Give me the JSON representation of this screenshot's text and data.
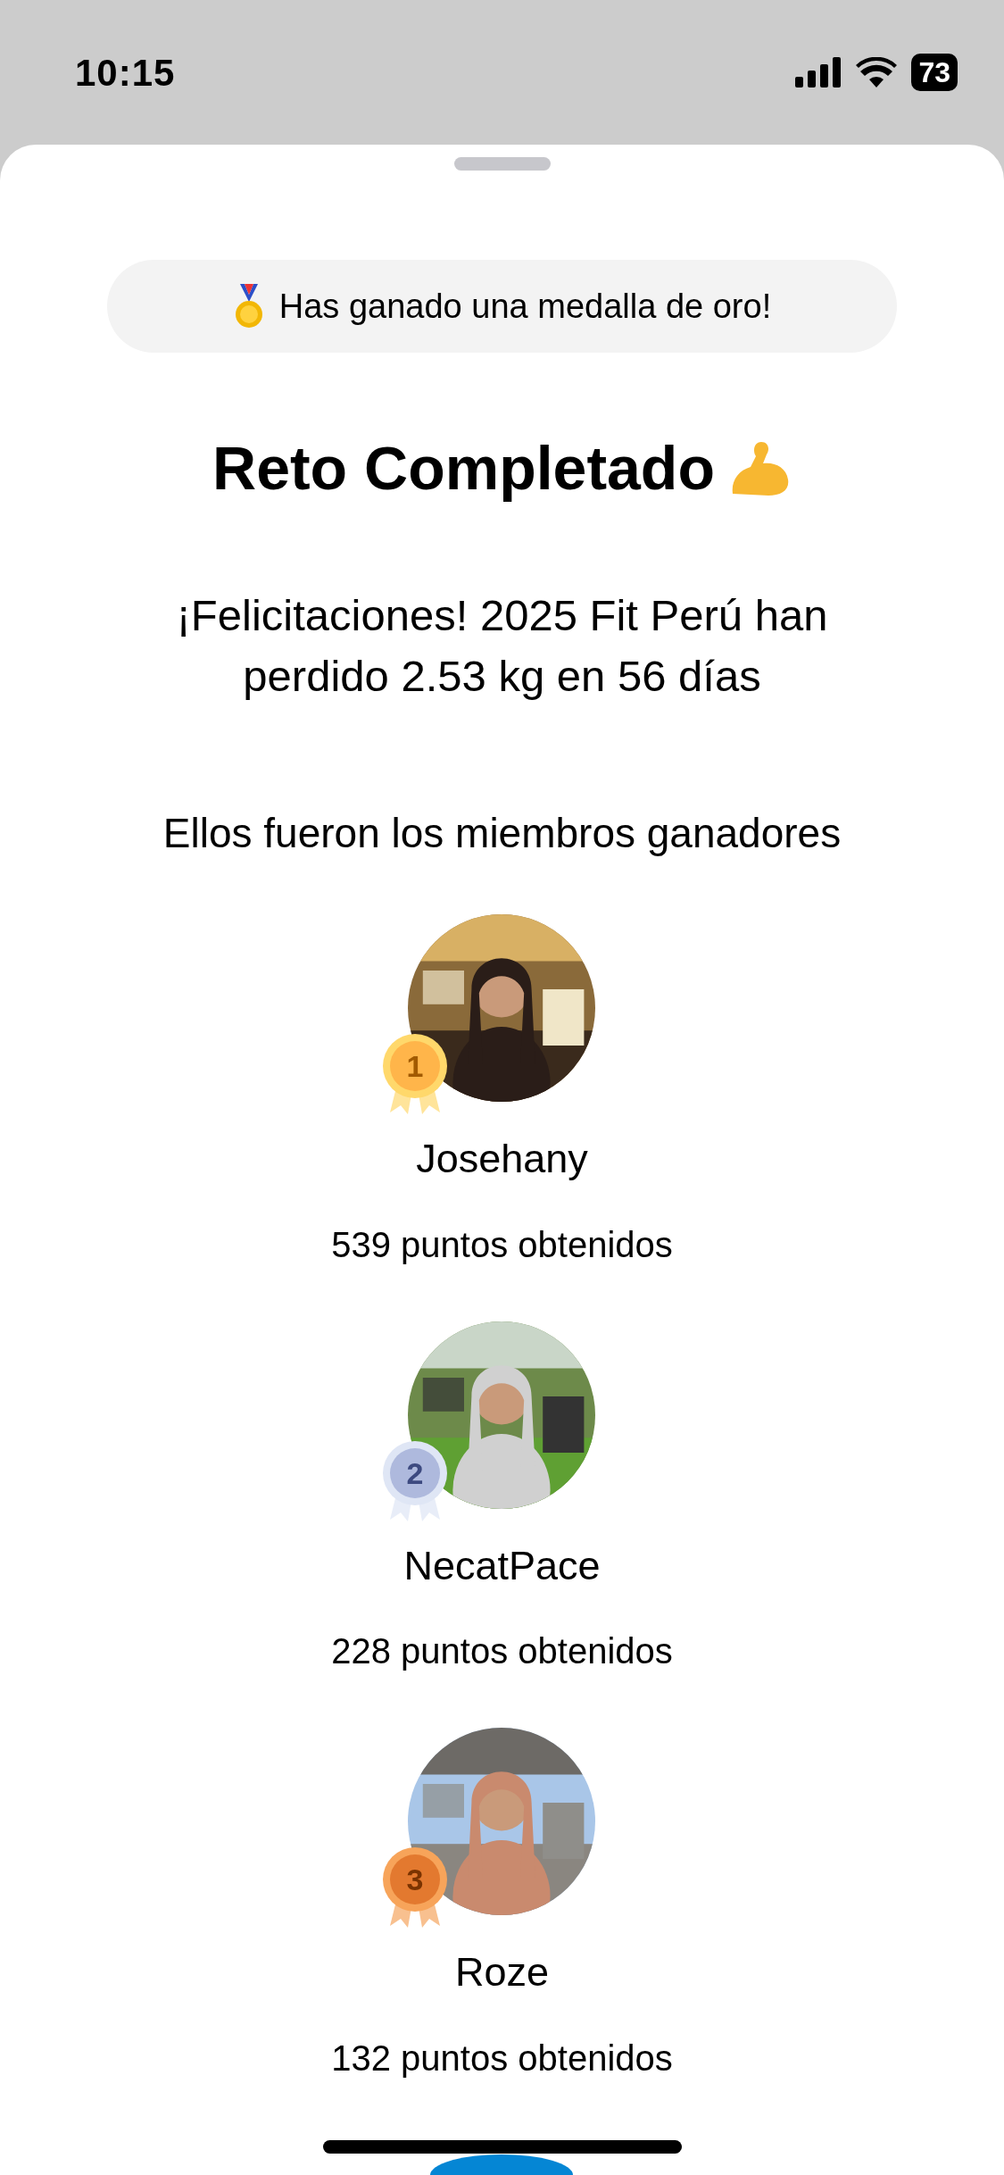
{
  "status_bar": {
    "time": "10:15",
    "battery": "73"
  },
  "banner": {
    "text": "Has ganado una medalla de oro!"
  },
  "title": "Reto Completado",
  "message": "¡Felicitaciones! 2025 Fit Perú han perdido 2.53 kg en 56 días",
  "winners_heading": "Ellos fueron los miembros ganadores",
  "winners": [
    {
      "rank": "1",
      "name": "Josehany",
      "points": "539 puntos obtenidos"
    },
    {
      "rank": "2",
      "name": "NecatPace",
      "points": "228 puntos obtenidos"
    },
    {
      "rank": "3",
      "name": "Roze",
      "points": "132 puntos obtenidos"
    }
  ]
}
